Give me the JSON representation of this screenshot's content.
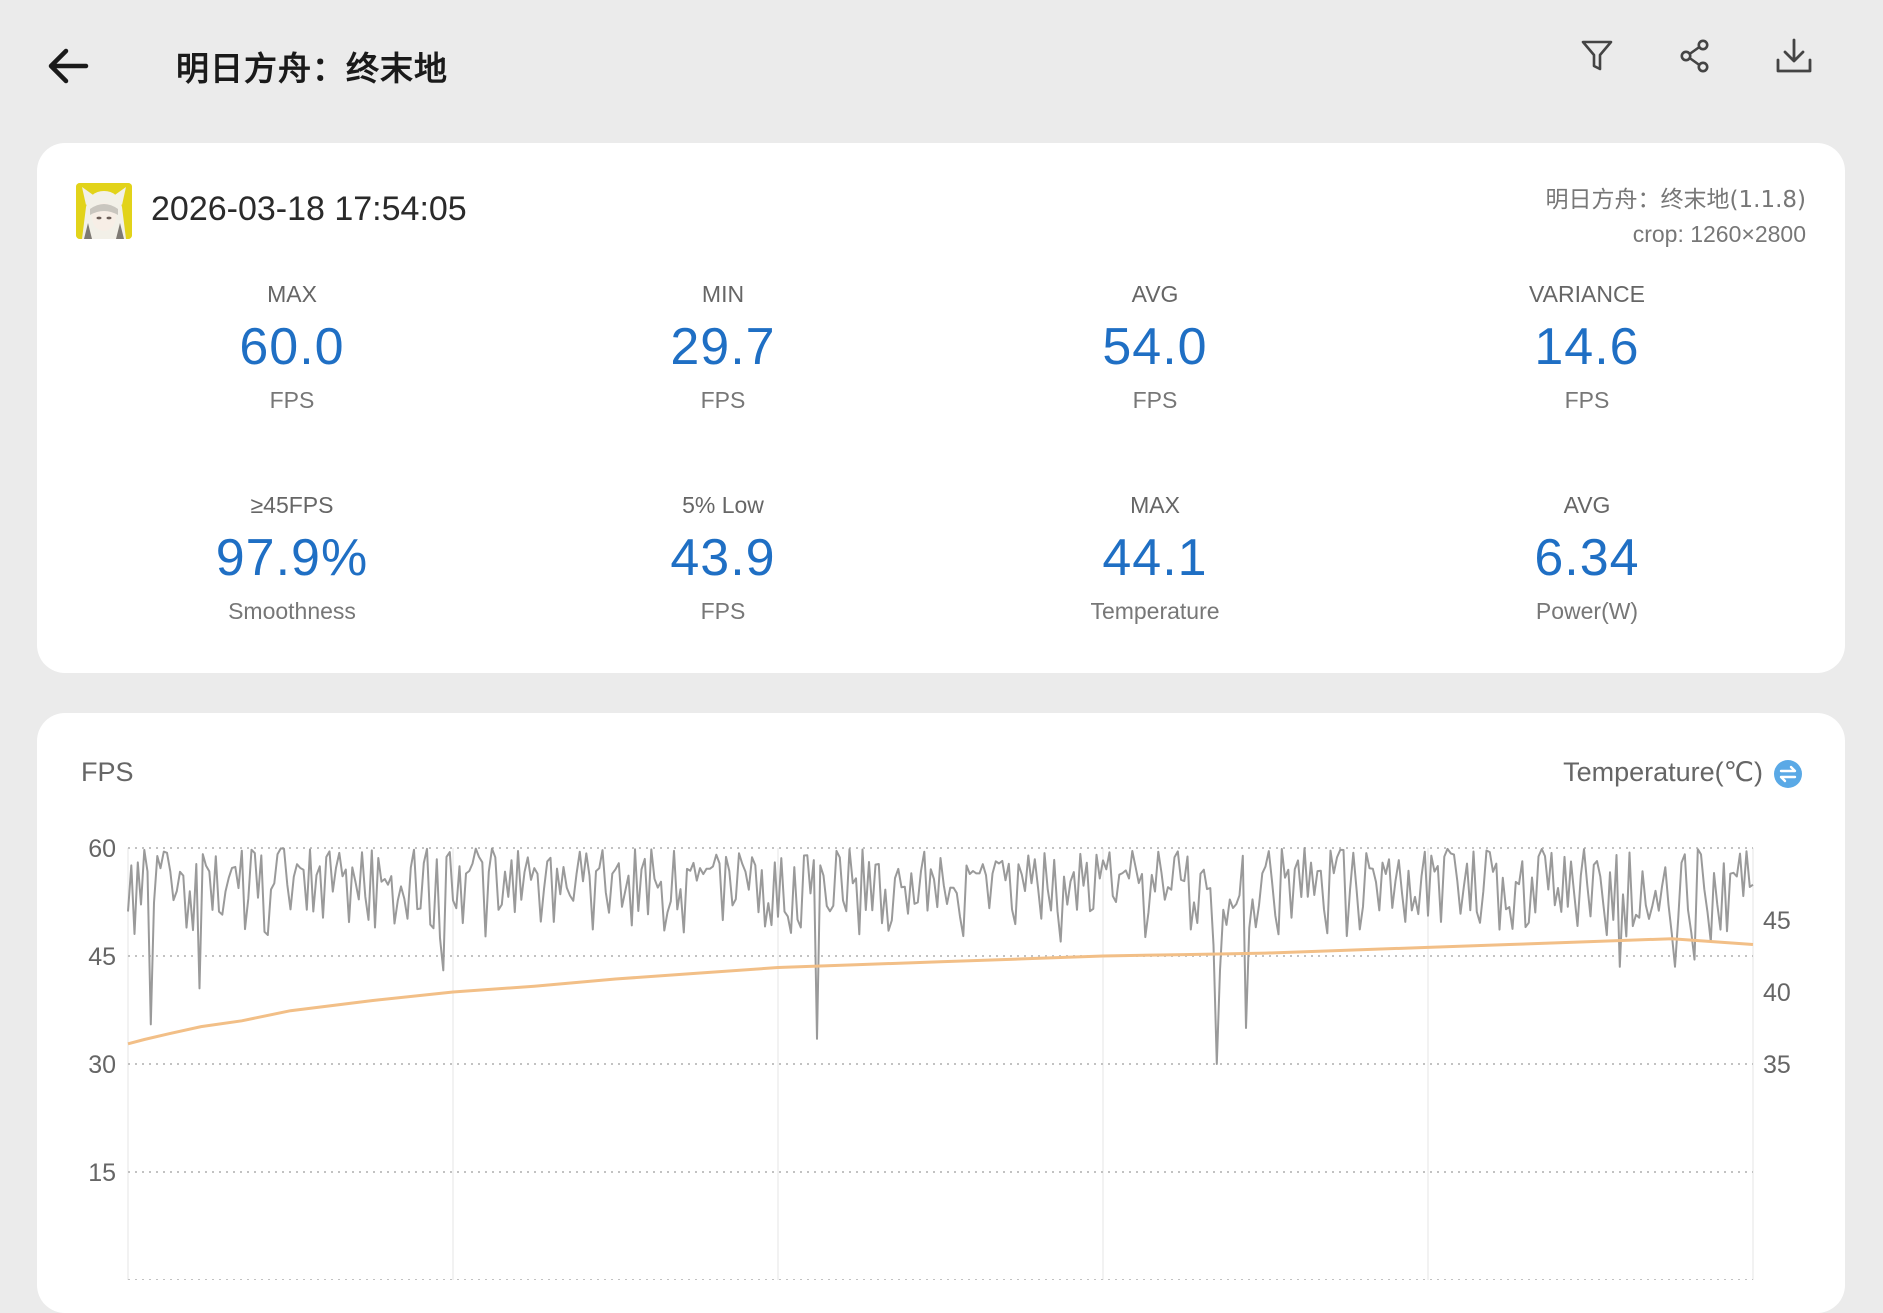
{
  "header": {
    "title": "明日方舟：终末地",
    "back_icon": "arrow-left-icon",
    "actions": [
      {
        "name": "filter",
        "icon": "filter-icon"
      },
      {
        "name": "share",
        "icon": "share-icon"
      },
      {
        "name": "download",
        "icon": "download-icon"
      }
    ]
  },
  "session": {
    "timestamp": "2026-03-18 17:54:05",
    "app_name": "明日方舟：终末地(1.1.8)",
    "crop": "crop: 1260×2800"
  },
  "stats": [
    {
      "label": "MAX",
      "value": "60.0",
      "unit": "FPS"
    },
    {
      "label": "MIN",
      "value": "29.7",
      "unit": "FPS"
    },
    {
      "label": "AVG",
      "value": "54.0",
      "unit": "FPS"
    },
    {
      "label": "VARIANCE",
      "value": "14.6",
      "unit": "FPS"
    },
    {
      "label": "≥45FPS",
      "value": "97.9%",
      "unit": "Smoothness"
    },
    {
      "label": "5% Low",
      "value": "43.9",
      "unit": "FPS"
    },
    {
      "label": "MAX",
      "value": "44.1",
      "unit": "Temperature"
    },
    {
      "label": "AVG",
      "value": "6.34",
      "unit": "Power(W)"
    }
  ],
  "colors": {
    "accent": "#1f6fc4",
    "fps_line": "#9a9a9a",
    "temp_line": "#f2bf87",
    "toggle": "#5aa9e6"
  },
  "chart": {
    "y_label": "FPS",
    "y2_label": "Temperature(℃)",
    "toggle_icon": "swap-axis-icon"
  },
  "chart_data": {
    "type": "line",
    "xlabel": "",
    "ylabel": "FPS",
    "y2label": "Temperature(℃)",
    "ylim": [
      0,
      60
    ],
    "y2lim": [
      20,
      50
    ],
    "y_ticks": [
      15,
      30,
      45,
      60
    ],
    "y2_ticks": [
      35,
      40,
      45
    ],
    "grid": true,
    "legend": "none",
    "x_range": [
      0,
      1000
    ],
    "series": [
      {
        "axis": "left",
        "color": "#9a9a9a",
        "summary": {
          "max": 60.0,
          "min": 29.7,
          "avg": 54.0
        },
        "dips": [
          {
            "x": 15,
            "y": 35.5
          },
          {
            "x": 45,
            "y": 40.5
          },
          {
            "x": 192,
            "y": 47.5
          },
          {
            "x": 195,
            "y": 43.0
          },
          {
            "x": 425,
            "y": 33.5
          },
          {
            "x": 575,
            "y": 47.0
          },
          {
            "x": 668,
            "y": 46.5
          },
          {
            "x": 673,
            "y": 43.0
          },
          {
            "x": 689,
            "y": 48.0
          },
          {
            "x": 694,
            "y": 49.0
          },
          {
            "x": 671,
            "y": 30.0
          },
          {
            "x": 695,
            "y": 30.5
          },
          {
            "x": 688,
            "y": 35.0
          },
          {
            "x": 919,
            "y": 43.5
          },
          {
            "x": 952,
            "y": 43.5
          },
          {
            "x": 965,
            "y": 44.5
          },
          {
            "x": 975,
            "y": 47.0
          }
        ]
      },
      {
        "axis": "right",
        "color": "#f2bf87",
        "summary": {
          "max": 44.1
        },
        "points": [
          {
            "x": 0,
            "y": 36.4
          },
          {
            "x": 10,
            "y": 36.7
          },
          {
            "x": 25,
            "y": 37.1
          },
          {
            "x": 45,
            "y": 37.6
          },
          {
            "x": 70,
            "y": 38.0
          },
          {
            "x": 100,
            "y": 38.7
          },
          {
            "x": 150,
            "y": 39.4
          },
          {
            "x": 200,
            "y": 40.0
          },
          {
            "x": 250,
            "y": 40.4
          },
          {
            "x": 300,
            "y": 40.9
          },
          {
            "x": 350,
            "y": 41.3
          },
          {
            "x": 400,
            "y": 41.7
          },
          {
            "x": 450,
            "y": 41.9
          },
          {
            "x": 500,
            "y": 42.1
          },
          {
            "x": 550,
            "y": 42.3
          },
          {
            "x": 600,
            "y": 42.5
          },
          {
            "x": 650,
            "y": 42.6
          },
          {
            "x": 700,
            "y": 42.7
          },
          {
            "x": 750,
            "y": 42.9
          },
          {
            "x": 800,
            "y": 43.1
          },
          {
            "x": 850,
            "y": 43.3
          },
          {
            "x": 900,
            "y": 43.5
          },
          {
            "x": 950,
            "y": 43.7
          },
          {
            "x": 975,
            "y": 43.5
          },
          {
            "x": 1000,
            "y": 43.3
          }
        ]
      }
    ]
  }
}
